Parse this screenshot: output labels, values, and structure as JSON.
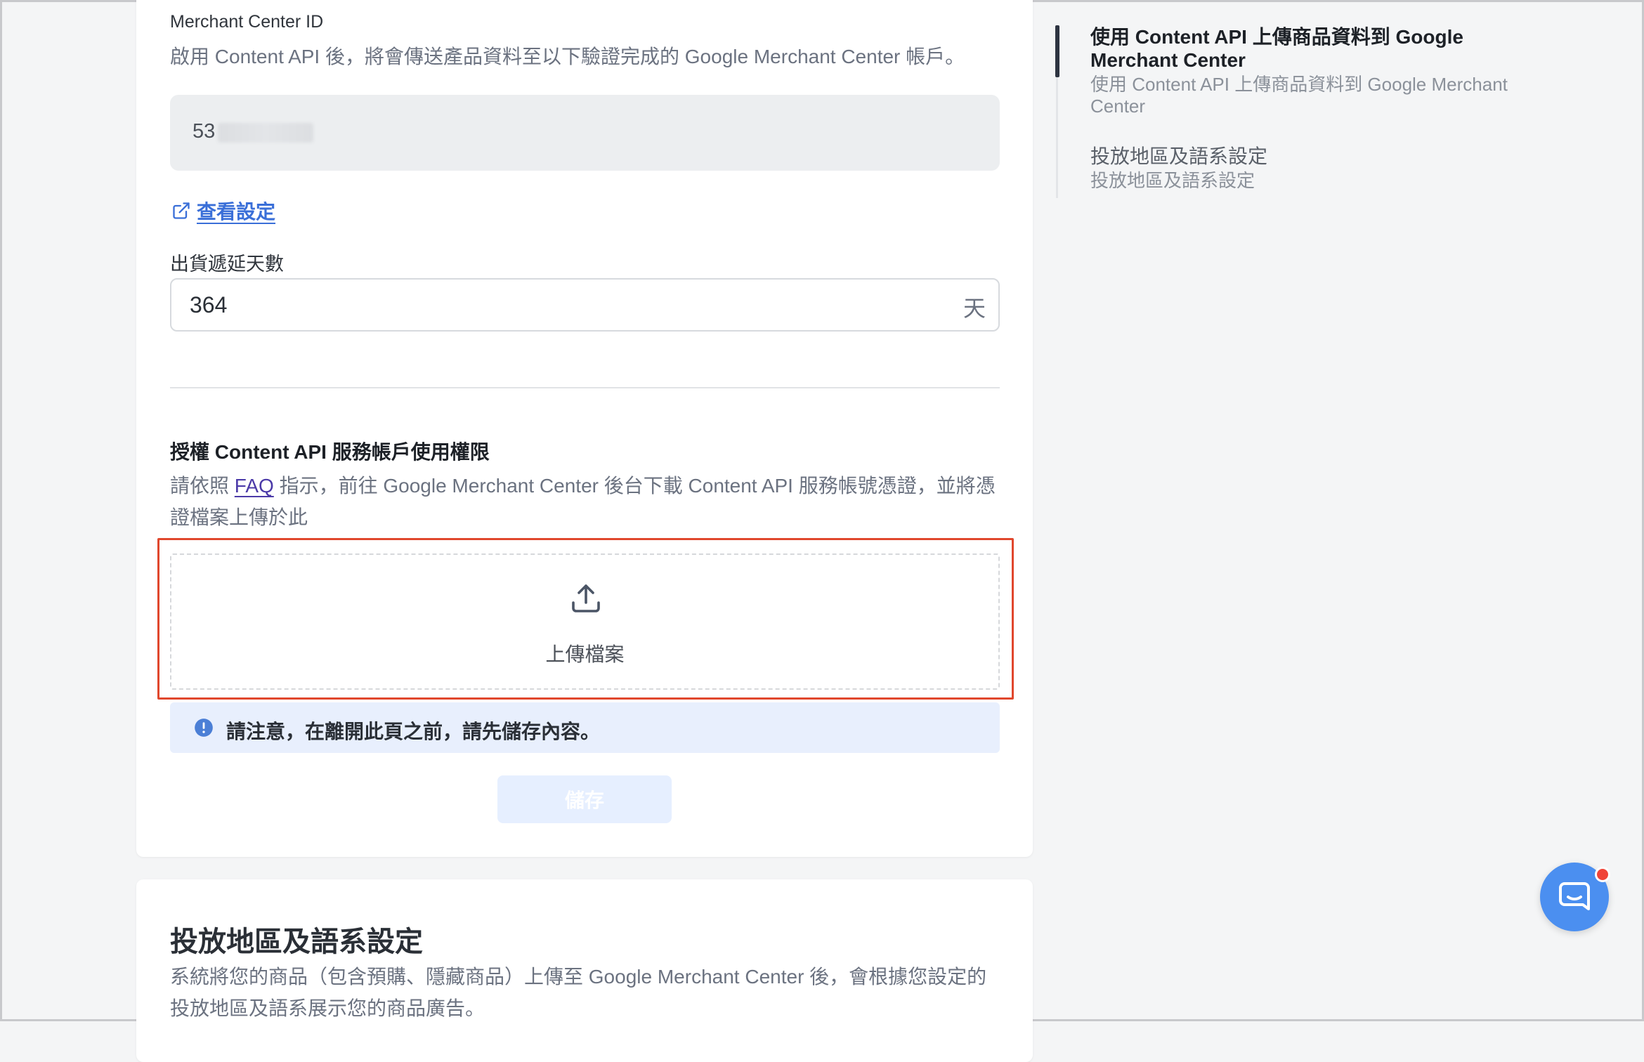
{
  "merchant": {
    "id_label": "Merchant Center ID",
    "id_description": "啟用 Content API 後，將會傳送產品資料至以下驗證完成的 Google Merchant Center 帳戶。",
    "id_value": "53",
    "view_settings_link": "查看設定"
  },
  "shipping": {
    "label": "出貨遞延天數",
    "value": "364",
    "suffix": "天"
  },
  "authorization": {
    "title": "授權 Content API 服務帳戶使用權限",
    "desc_before": "請依照 ",
    "faq_link": "FAQ",
    "desc_after": " 指示，前往 Google Merchant Center 後台下載 Content API 服務帳號憑證，並將憑證檔案上傳於此",
    "upload_label": "上傳檔案",
    "upload_icon": "upload-icon"
  },
  "notice": {
    "text": "請注意，在離開此頁之前，請先儲存內容。",
    "icon": "exclamation-circle-icon"
  },
  "save_button": "儲存",
  "region_card": {
    "title": "投放地區及語系設定",
    "description": "系統將您的商品（包含預購、隱藏商品）上傳至 Google Merchant Center 後，會根據您設定的投放地區及語系展示您的商品廣告。"
  },
  "toc": {
    "items": [
      {
        "title": "使用 Content API 上傳商品資料到 Google Merchant Center",
        "subtitle": "使用 Content API 上傳商品資料到 Google Merchant Center",
        "active": true
      },
      {
        "title": "投放地區及語系設定",
        "subtitle": "投放地區及語系設定",
        "active": false
      }
    ]
  },
  "chat_widget": {
    "icon": "chat-icon",
    "has_notification": true
  },
  "colors": {
    "accent_link": "#3a6fd8",
    "highlight_border": "#e0472d",
    "notice_bg": "#e8effd",
    "chat_button": "#4b8ff0"
  }
}
